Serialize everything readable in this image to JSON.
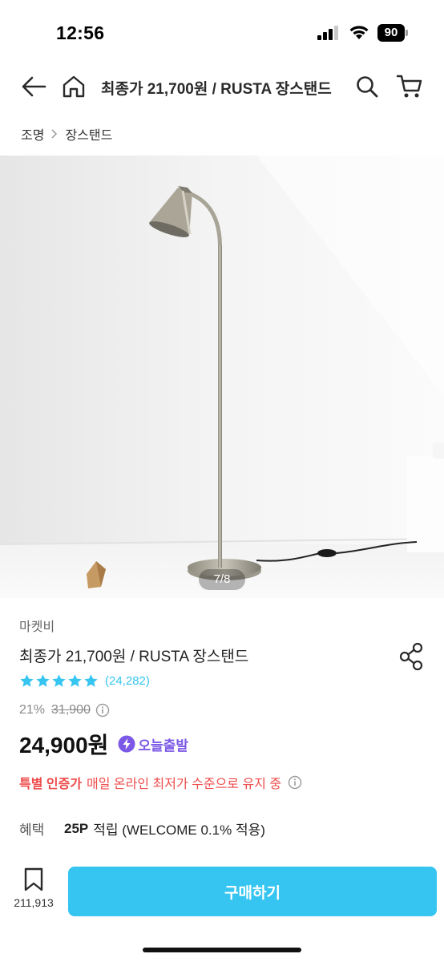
{
  "status_bar": {
    "time": "12:56",
    "battery": "90"
  },
  "header": {
    "title": "최종가 21,700원 / RUSTA 장스탠드",
    "icons": [
      "back-arrow-icon",
      "home-icon",
      "search-icon",
      "cart-icon"
    ]
  },
  "breadcrumb": [
    "조명",
    "장스탠드"
  ],
  "gallery": {
    "counter": "7/8",
    "current": 7,
    "total": 8
  },
  "product": {
    "seller": "마켓비",
    "name": "최종가 21,700원 / RUSTA 장스탠드",
    "rating": 5,
    "review_count": "(24,282)",
    "discount_rate": "21%",
    "original_price": "31,900",
    "price": "24,900원",
    "delivery_badge": "오늘출발"
  },
  "certification": {
    "title": "특별 인증가",
    "description": "매일 온라인 최저가 수준으로 유지 중"
  },
  "benefit": {
    "label": "혜택",
    "points": "25P",
    "description": "적립 (WELCOME 0.1% 적용)"
  },
  "bottom_bar": {
    "bookmark_count": "211,913",
    "buy_label": "구매하기"
  },
  "colors": {
    "accent": "#35c5f0",
    "cert_red": "#ef4b4b",
    "delivery_purple": "#7b58e6"
  }
}
